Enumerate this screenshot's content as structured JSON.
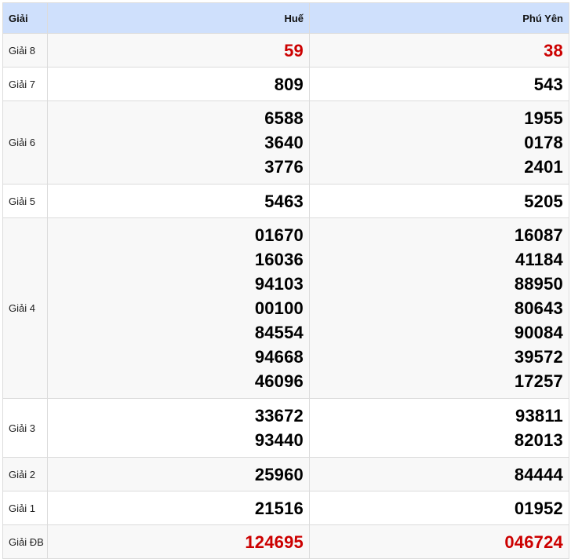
{
  "header": {
    "label": "Giải",
    "provinces": [
      "Huế",
      "Phú Yên"
    ]
  },
  "rows": [
    {
      "label": "Giải 8",
      "hue": [
        "59"
      ],
      "phuyen": [
        "38"
      ]
    },
    {
      "label": "Giải 7",
      "hue": [
        "809"
      ],
      "phuyen": [
        "543"
      ]
    },
    {
      "label": "Giải 6",
      "hue": [
        "6588",
        "3640",
        "3776"
      ],
      "phuyen": [
        "1955",
        "0178",
        "2401"
      ]
    },
    {
      "label": "Giải 5",
      "hue": [
        "5463"
      ],
      "phuyen": [
        "5205"
      ]
    },
    {
      "label": "Giải 4",
      "hue": [
        "01670",
        "16036",
        "94103",
        "00100",
        "84554",
        "94668",
        "46096"
      ],
      "phuyen": [
        "16087",
        "41184",
        "88950",
        "80643",
        "90084",
        "39572",
        "17257"
      ]
    },
    {
      "label": "Giải 3",
      "hue": [
        "33672",
        "93440"
      ],
      "phuyen": [
        "93811",
        "82013"
      ]
    },
    {
      "label": "Giải 2",
      "hue": [
        "25960"
      ],
      "phuyen": [
        "84444"
      ]
    },
    {
      "label": "Giải 1",
      "hue": [
        "21516"
      ],
      "phuyen": [
        "01952"
      ]
    },
    {
      "label": "Giải ĐB",
      "hue": [
        "124695"
      ],
      "phuyen": [
        "046724"
      ]
    }
  ],
  "colors": {
    "header_bg": "#cfe0fc",
    "highlight": "#cc0000"
  }
}
